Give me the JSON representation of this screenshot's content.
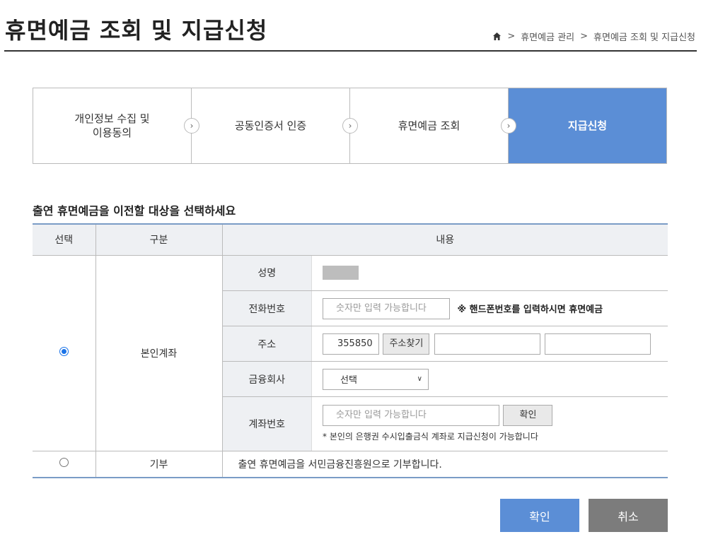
{
  "header": {
    "title": "휴면예금 조회 및 지급신청",
    "breadcrumb": [
      "휴면예금 관리",
      "휴면예금 조회 및 지급신청"
    ]
  },
  "steps": [
    {
      "label": "개인정보 수집 및\n이용동의",
      "active": false
    },
    {
      "label": "공동인증서 인증",
      "active": false
    },
    {
      "label": "휴면예금 조회",
      "active": false
    },
    {
      "label": "지급신청",
      "active": true
    }
  ],
  "section_title": "출연 휴면예금을 이전할 대상을 선택하세요",
  "table": {
    "headers": [
      "선택",
      "구분",
      "내용"
    ],
    "own_account": {
      "label": "본인계좌",
      "selected": true,
      "fields": {
        "name_label": "성명",
        "phone_label": "전화번호",
        "phone_placeholder": "숫자만 입력 가능합니다",
        "phone_note": "※ 핸드폰번호를 입력하시면 휴면예금",
        "address_label": "주소",
        "postal_code": "355850",
        "address_search_button": "주소찾기",
        "bank_label": "금융회사",
        "bank_selected": "선택",
        "account_label": "계좌번호",
        "account_placeholder": "숫자만 입력 가능합니다",
        "account_confirm_button": "확인",
        "account_note": "* 본인의 은행권 수시입출금식 계좌로 지급신청이 가능합니다"
      }
    },
    "donation": {
      "label": "기부",
      "selected": false,
      "text": "출연 휴면예금을 서민금융진흥원으로 기부합니다."
    }
  },
  "buttons": {
    "confirm": "확인",
    "cancel": "취소"
  },
  "colors": {
    "accent": "#5b8ed6",
    "cancel": "#7c7c7c",
    "table_border": "#7a9cc6"
  }
}
